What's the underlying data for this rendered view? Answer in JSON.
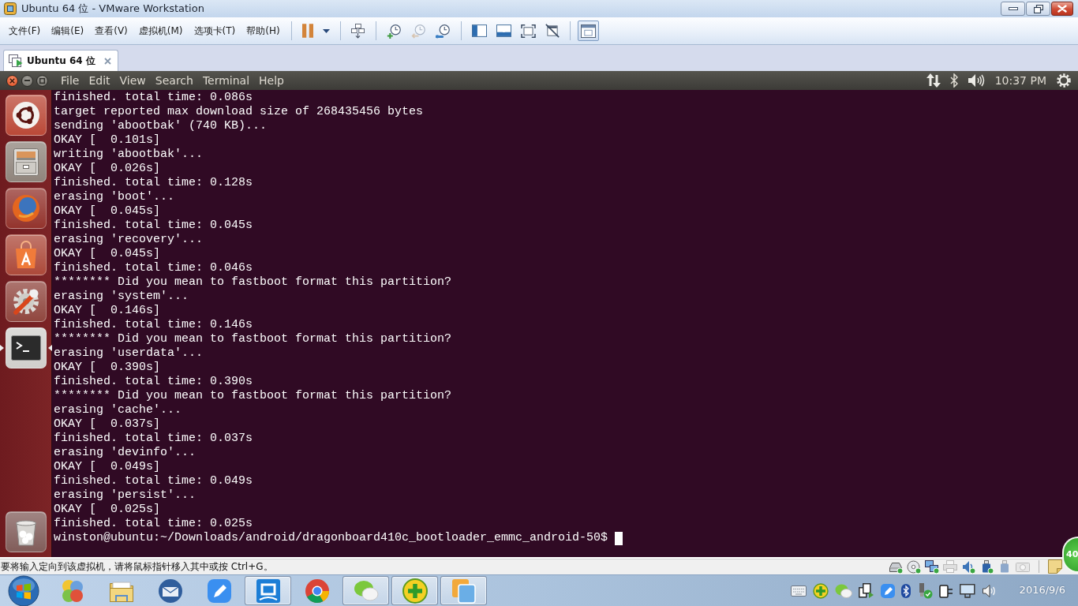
{
  "window": {
    "title": "Ubuntu 64 位 - VMware Workstation"
  },
  "menu_bar": {
    "items": [
      "文件(F)",
      "编辑(E)",
      "查看(V)",
      "虚拟机(M)",
      "选项卡(T)",
      "帮助(H)"
    ]
  },
  "toolbar": {
    "groups": [
      [
        {
          "kind": "pause",
          "pressed": false,
          "disabled": false
        }
      ],
      [
        {
          "kind": "send-keys",
          "pressed": false,
          "disabled": false
        }
      ],
      [
        {
          "kind": "snapshot-take",
          "pressed": false,
          "disabled": false
        },
        {
          "kind": "snapshot-revert",
          "pressed": false,
          "disabled": true
        },
        {
          "kind": "snapshot-manager",
          "pressed": false,
          "disabled": false
        }
      ],
      [
        {
          "kind": "sidebar",
          "pressed": false,
          "disabled": false
        },
        {
          "kind": "thumbnail-bar",
          "pressed": false,
          "disabled": false
        },
        {
          "kind": "full-screen",
          "pressed": false,
          "disabled": false
        },
        {
          "kind": "unity",
          "pressed": false,
          "disabled": false
        }
      ],
      [
        {
          "kind": "console-view",
          "pressed": true,
          "disabled": false
        }
      ]
    ]
  },
  "tabs": [
    {
      "label": "Ubuntu 64 位",
      "selected": true
    }
  ],
  "guest_panel": {
    "menu": [
      "File",
      "Edit",
      "View",
      "Search",
      "Terminal",
      "Help"
    ],
    "clock": "10:37 PM"
  },
  "launcher": {
    "items": [
      {
        "kind": "dash",
        "running": false,
        "focused": false
      },
      {
        "kind": "files",
        "running": false,
        "focused": false
      },
      {
        "kind": "browser",
        "running": false,
        "focused": false
      },
      {
        "kind": "software-center",
        "running": false,
        "focused": false
      },
      {
        "kind": "settings",
        "running": false,
        "focused": false
      },
      {
        "kind": "terminal",
        "running": true,
        "focused": true
      }
    ],
    "bottom_items": [
      {
        "kind": "trash",
        "running": false,
        "focused": false
      }
    ]
  },
  "terminal": {
    "lines": [
      "finished. total time: 0.086s",
      "target reported max download size of 268435456 bytes",
      "sending 'abootbak' (740 KB)...",
      "OKAY [  0.101s]",
      "writing 'abootbak'...",
      "OKAY [  0.026s]",
      "finished. total time: 0.128s",
      "erasing 'boot'...",
      "OKAY [  0.045s]",
      "finished. total time: 0.045s",
      "erasing 'recovery'...",
      "OKAY [  0.045s]",
      "finished. total time: 0.046s",
      "******** Did you mean to fastboot format this partition?",
      "erasing 'system'...",
      "OKAY [  0.146s]",
      "finished. total time: 0.146s",
      "******** Did you mean to fastboot format this partition?",
      "erasing 'userdata'...",
      "OKAY [  0.390s]",
      "finished. total time: 0.390s",
      "******** Did you mean to fastboot format this partition?",
      "erasing 'cache'...",
      "OKAY [  0.037s]",
      "finished. total time: 0.037s",
      "erasing 'devinfo'...",
      "OKAY [  0.049s]",
      "finished. total time: 0.049s",
      "erasing 'persist'...",
      "OKAY [  0.025s]",
      "finished. total time: 0.025s"
    ],
    "prompt": "winston@ubuntu:~/Downloads/android/dragonboard410c_bootloader_emmc_android-50$",
    "cursor": true
  },
  "status_bar": {
    "message": "要将输入定向到该虚拟机，请将鼠标指针移入其中或按 Ctrl+G。",
    "devices": [
      {
        "kind": "hard-disk",
        "connected": true
      },
      {
        "kind": "cd-drive",
        "connected": true
      },
      {
        "kind": "network",
        "connected": true
      },
      {
        "kind": "printer",
        "connected": false
      },
      {
        "kind": "sound",
        "connected": true
      },
      {
        "kind": "usb",
        "connected": true
      },
      {
        "kind": "usb",
        "connected": false
      },
      {
        "kind": "camera",
        "connected": false
      }
    ]
  },
  "taskbar": {
    "apps": [
      {
        "kind": "balls",
        "running": false
      },
      {
        "kind": "folder",
        "running": false
      },
      {
        "kind": "mail",
        "running": false
      },
      {
        "kind": "pencil",
        "running": false
      },
      {
        "kind": "tile",
        "running": true
      },
      {
        "kind": "ring",
        "running": false
      },
      {
        "kind": "chat",
        "running": true
      },
      {
        "kind": "plus",
        "running": true
      },
      {
        "kind": "squares",
        "running": true
      }
    ],
    "date": "2016/9/6"
  },
  "floating_ball": {
    "text": "40"
  }
}
